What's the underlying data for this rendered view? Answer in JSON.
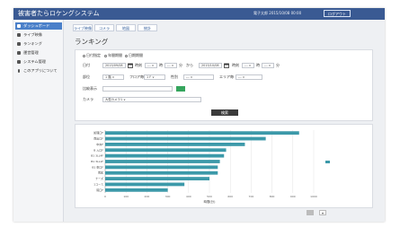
{
  "app": {
    "title": "被害者たらロケングシステム",
    "user_info": "電子太郎  2015/10/08 00:00",
    "logout": "ログアウト"
  },
  "sidebar": {
    "items": [
      {
        "label": "ダッシュボード",
        "active": true
      },
      {
        "label": "ライブ映像",
        "active": false
      },
      {
        "label": "ランキング",
        "active": false
      },
      {
        "label": "運営管理",
        "active": false
      },
      {
        "label": "システム管理",
        "active": false
      },
      {
        "label": "このアプリについて",
        "active": false
      }
    ]
  },
  "tabs": [
    "ライブ映像",
    "コメラ",
    "地図",
    "統計"
  ],
  "page": {
    "title": "ランキング"
  },
  "form": {
    "radio_1": "日付指定",
    "radio_2": "年間期間",
    "radio_3": "日期期間",
    "date_label": "日付",
    "date_from": "2015/09/08",
    "time_label": "時刻",
    "hour_from": "--- ∨",
    "hour_unit": "時",
    "min_from": "--- ∨",
    "min_unit": "分",
    "range_sep": "から",
    "date_to": "2015/10/08",
    "time_label_2": "時刻",
    "hour_to": "--- ∨",
    "hour_unit_2": "時",
    "min_to": "--- ∨",
    "min_unit_2": "分",
    "floor_label": "部位",
    "floor_value": "1 階  ∨",
    "area_label": "フロア毎",
    "area_value": "1 F  ∨",
    "gender_label": "性別",
    "gender_value": "---  ∨",
    "age_label": "エリア毎",
    "age_value": "---  ∨",
    "name_label": "比較表示",
    "camera_label": "カメラ",
    "camera_value": "大型カメラ1   ∨",
    "search_button": "検索"
  },
  "chart_data": {
    "type": "bar",
    "orientation": "horizontal",
    "categories": [
      "処理口F",
      "南出口F",
      "中央F",
      "B 入口F",
      "B1 3LL4F",
      "B1 3LL1F",
      "B1 東口F",
      "南区",
      "ナーズ",
      "1コース",
      "院口F"
    ],
    "series": [
      {
        "name": "",
        "values": [
          930,
          770,
          670,
          580,
          570,
          550,
          540,
          540,
          500,
          380,
          300
        ]
      }
    ],
    "xlim": [
      0,
      1000
    ],
    "x_ticks": [
      0,
      100,
      200,
      300,
      400,
      500,
      600,
      700,
      800,
      900,
      1000
    ],
    "xlabel": "時間(分)",
    "legend": "right",
    "bar_color": "#3c99a9"
  },
  "pager": {
    "prev": "",
    "next": "▾"
  }
}
